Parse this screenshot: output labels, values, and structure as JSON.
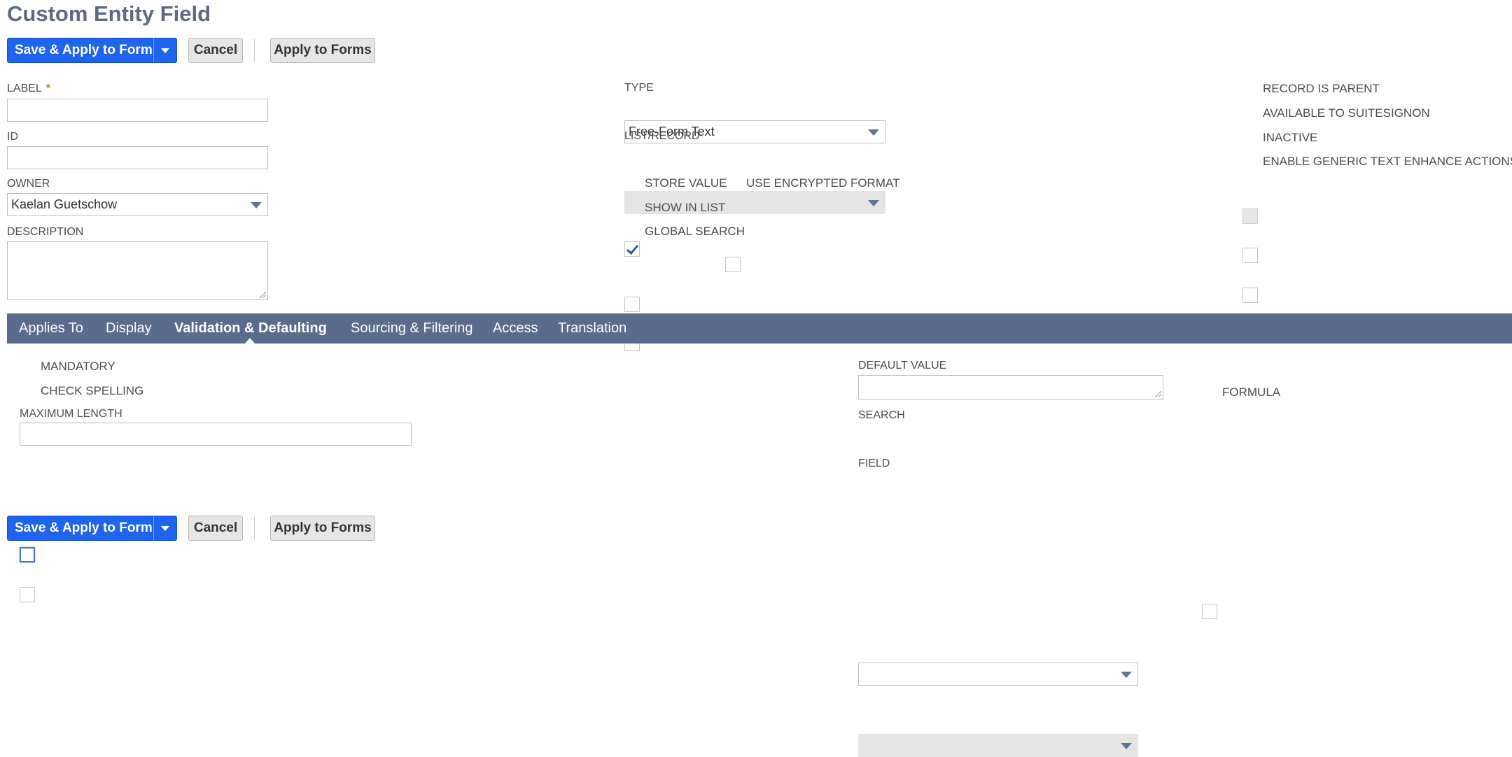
{
  "page": {
    "title": "Custom Entity Field"
  },
  "toolbar": {
    "save_apply_label": "Save & Apply to Forms",
    "cancel_label": "Cancel",
    "apply_label": "Apply to Forms"
  },
  "fields": {
    "label": {
      "label": "LABEL",
      "required": "*",
      "value": ""
    },
    "id": {
      "label": "ID",
      "value": ""
    },
    "owner": {
      "label": "OWNER",
      "value": "Kaelan Guetschow"
    },
    "description": {
      "label": "DESCRIPTION",
      "value": ""
    },
    "type": {
      "label": "TYPE",
      "value": "Free-Form Text"
    },
    "list_record": {
      "label": "LIST/RECORD",
      "value": ""
    }
  },
  "checkboxes": {
    "store_value": {
      "label": "STORE VALUE",
      "checked": true
    },
    "use_encrypted": {
      "label": "USE ENCRYPTED FORMAT",
      "checked": false
    },
    "show_in_list": {
      "label": "SHOW IN LIST",
      "checked": false
    },
    "global_search": {
      "label": "GLOBAL SEARCH",
      "checked": false
    },
    "record_is_parent": {
      "label": "RECORD IS PARENT",
      "checked": false,
      "disabled": true
    },
    "available_suitesignon": {
      "label": "AVAILABLE TO SUITESIGNON",
      "checked": false
    },
    "inactive": {
      "label": "INACTIVE",
      "checked": false
    },
    "enable_generic": {
      "label": "ENABLE GENERIC TEXT ENHANCE ACTIONS",
      "checked": false,
      "disabled": true
    }
  },
  "tabs": [
    {
      "label": "Applies To",
      "active": false
    },
    {
      "label": "Display",
      "active": false
    },
    {
      "label": "Validation & Defaulting",
      "active": true
    },
    {
      "label": "Sourcing & Filtering",
      "active": false
    },
    {
      "label": "Access",
      "active": false
    },
    {
      "label": "Translation",
      "active": false
    }
  ],
  "validation": {
    "mandatory": {
      "label": "MANDATORY",
      "checked": false
    },
    "check_spelling": {
      "label": "CHECK SPELLING",
      "checked": false
    },
    "maximum_length": {
      "label": "MAXIMUM LENGTH",
      "value": ""
    },
    "default_value": {
      "label": "DEFAULT VALUE",
      "value": ""
    },
    "formula": {
      "label": "FORMULA",
      "checked": false
    },
    "search": {
      "label": "SEARCH",
      "value": ""
    },
    "field": {
      "label": "FIELD",
      "value": ""
    }
  },
  "colors": {
    "primary": "#1f64ee",
    "tabbar": "#5a6c8b",
    "title": "#5d6a80",
    "required": "#b8860b"
  },
  "icons": {
    "split_caret": "caret-down-icon",
    "select_caret": "chevron-down-icon",
    "check": "checkmark-icon"
  }
}
